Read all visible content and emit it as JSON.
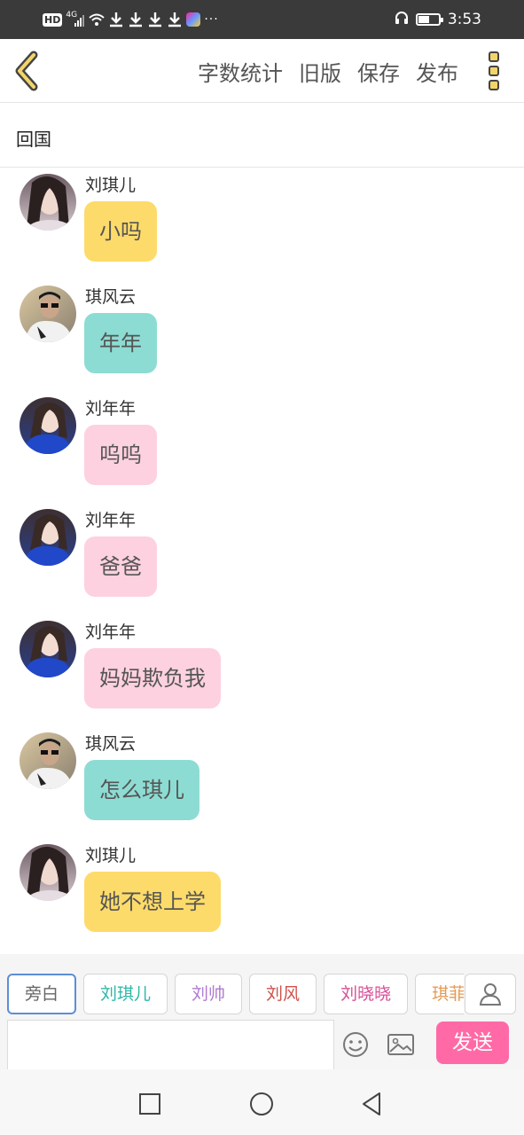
{
  "status_bar": {
    "hd": "HD",
    "network": "4G",
    "time": "3:53",
    "battery_level": 0.55,
    "more": "···"
  },
  "header": {
    "actions": [
      "字数统计",
      "旧版",
      "保存",
      "发布"
    ]
  },
  "title": "回国",
  "bubble_colors": {
    "yellow": "#fddb6a",
    "teal": "#8ddcd3",
    "pink": "#fdd1df"
  },
  "messages": [
    {
      "name": "刘琪儿",
      "text": "小吗",
      "color": "yellow",
      "avatar": "avatar-liu-qier"
    },
    {
      "name": "琪风云",
      "text": "年年",
      "color": "teal",
      "avatar": "avatar-qi-fengyun"
    },
    {
      "name": "刘年年",
      "text": "呜呜",
      "color": "pink",
      "avatar": "avatar-liu-niannian"
    },
    {
      "name": "刘年年",
      "text": "爸爸",
      "color": "pink",
      "avatar": "avatar-liu-niannian"
    },
    {
      "name": "刘年年",
      "text": "妈妈欺负我",
      "color": "pink",
      "avatar": "avatar-liu-niannian"
    },
    {
      "name": "琪风云",
      "text": "怎么琪儿",
      "color": "teal",
      "avatar": "avatar-qi-fengyun"
    },
    {
      "name": "刘琪儿",
      "text": "她不想上学",
      "color": "yellow",
      "avatar": "avatar-liu-qier"
    }
  ],
  "characters": [
    {
      "label": "旁白",
      "color": "#666666",
      "active": true
    },
    {
      "label": "刘琪儿",
      "color": "#2cb8a8",
      "active": false
    },
    {
      "label": "刘帅",
      "color": "#b07ad0",
      "active": false
    },
    {
      "label": "刘风",
      "color": "#d0504a",
      "active": false
    },
    {
      "label": "刘晓晓",
      "color": "#d84f97",
      "active": false
    },
    {
      "label": "琪菲",
      "color": "#e59a55",
      "active": false
    }
  ],
  "input": {
    "value": "",
    "placeholder": ""
  },
  "send_label": "发送"
}
